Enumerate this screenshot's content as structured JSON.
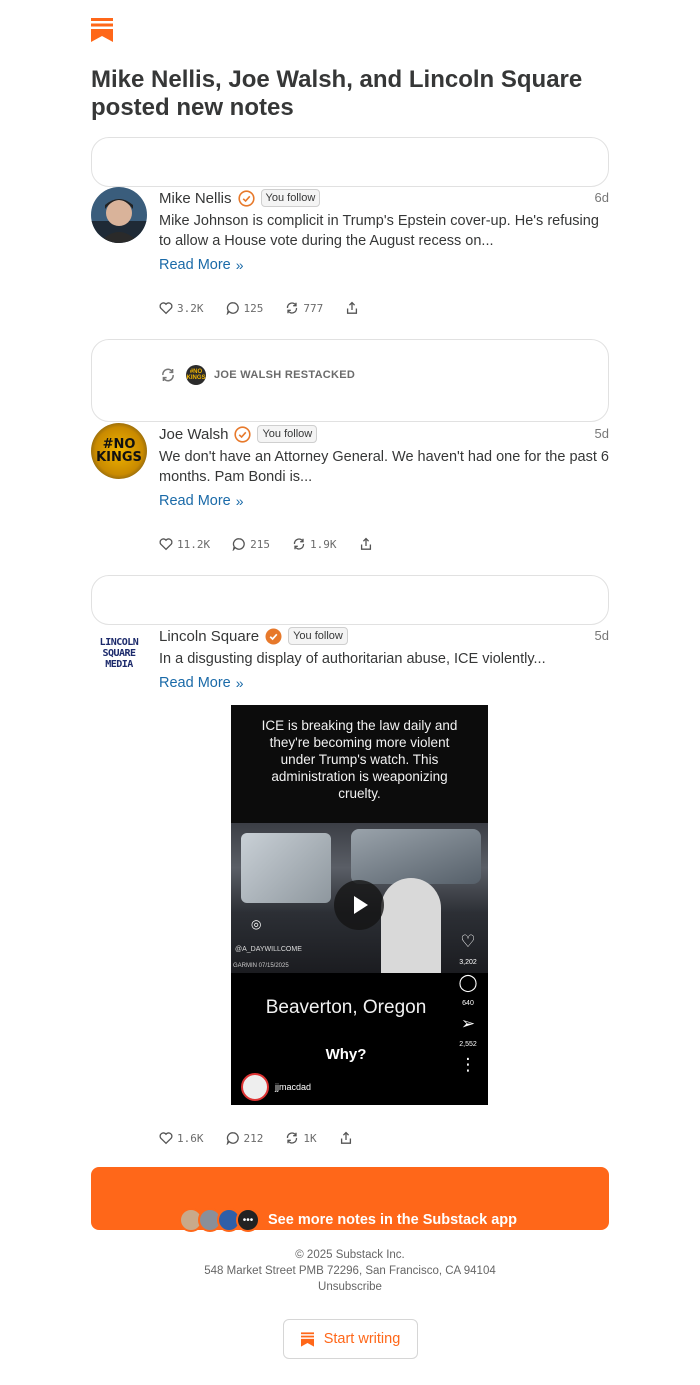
{
  "headline": "Mike Nellis, Joe Walsh, and Lincoln Square posted new notes",
  "brand_color": "#ff6719",
  "link_color": "#1a6aa8",
  "notes": [
    {
      "author": "Mike Nellis",
      "follow_badge": "You follow",
      "time": "6d",
      "text": "Mike Johnson is complicit in Trump's Epstein cover-up. He's refusing to allow a House vote during the August recess on...",
      "read_more": "Read More",
      "likes": "3.2K",
      "comments": "125",
      "restacks": "777",
      "verified_color": "#e7792b"
    },
    {
      "restack_label": "JOE WALSH RESTACKED",
      "author": "Joe Walsh",
      "avatar_text": "#NO KINGS",
      "follow_badge": "You follow",
      "time": "5d",
      "text": "We don't have an Attorney General. We haven't had one for the past 6 months. Pam Bondi is...",
      "read_more": "Read More",
      "likes": "11.2K",
      "comments": "215",
      "restacks": "1.9K",
      "verified_color": "#e7792b"
    },
    {
      "author": "Lincoln Square",
      "avatar_text": "LINCOLN SQUARE MEDIA",
      "follow_badge": "You follow",
      "time": "5d",
      "text": "In a disgusting display of authoritarian abuse, ICE violently...",
      "read_more": "Read More",
      "likes": "1.6K",
      "comments": "212",
      "restacks": "1K",
      "verified_color": "#e7792b",
      "media": {
        "caption": "ICE is breaking the law daily and they're becoming more violent under Trump's watch. This administration is weaponizing cruelty.",
        "location": "Beaverton, Oregon",
        "question": "Why?",
        "handle_watermark": "@A_DAYWILLCOME",
        "gps_overlay": "GARMIN 07/15/2025",
        "side_likes": "3,202",
        "side_comments": "640",
        "side_shares": "2,552",
        "username": "jjmacdad"
      }
    }
  ],
  "cta": {
    "label": "See more notes in the Substack app"
  },
  "footer": {
    "copyright": "© 2025 Substack Inc.",
    "address": "548 Market Street PMB 72296, San Francisco, CA 94104",
    "unsubscribe": "Unsubscribe"
  },
  "start_writing": "Start writing",
  "icons": {
    "logo": "substack-logo-icon",
    "verified": "verified-check-icon",
    "like": "heart-icon",
    "comment": "comment-icon",
    "restack": "restack-icon",
    "share": "share-icon",
    "read_more": "chevron-double-right-icon"
  }
}
